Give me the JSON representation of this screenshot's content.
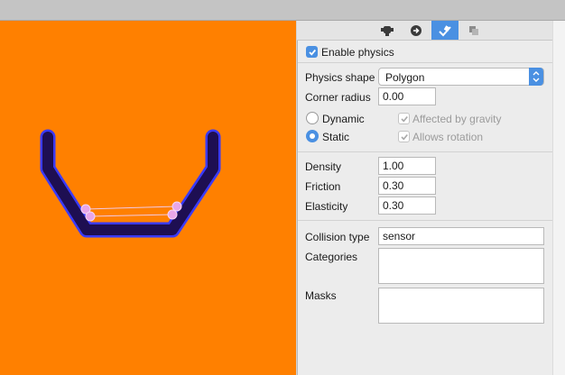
{
  "tabs": [
    {
      "icon": "node-icon",
      "active": false
    },
    {
      "icon": "arrow-circle-icon",
      "active": false
    },
    {
      "icon": "pin-icon",
      "active": true
    },
    {
      "icon": "layers-icon",
      "active": false
    }
  ],
  "physics": {
    "enable_label": "Enable physics",
    "enabled": true,
    "shape_label": "Physics shape",
    "shape_value": "Polygon",
    "corner_radius_label": "Corner radius",
    "corner_radius_value": "0.00",
    "dynamic_label": "Dynamic",
    "static_label": "Static",
    "body_type": "Static",
    "affected_by_gravity_label": "Affected by gravity",
    "allows_rotation_label": "Allows rotation"
  },
  "material": {
    "density_label": "Density",
    "density_value": "1.00",
    "friction_label": "Friction",
    "friction_value": "0.30",
    "elasticity_label": "Elasticity",
    "elasticity_value": "0.30"
  },
  "collision": {
    "type_label": "Collision type",
    "type_value": "sensor",
    "categories_label": "Categories",
    "categories_value": "",
    "masks_label": "Masks",
    "masks_value": ""
  },
  "colors": {
    "canvas_bg": "#ff8000",
    "accent": "#4a90e2",
    "shape_fill": "#1e0f52",
    "shape_outline": "#3a3aff",
    "handle": "#e8a6e8"
  }
}
